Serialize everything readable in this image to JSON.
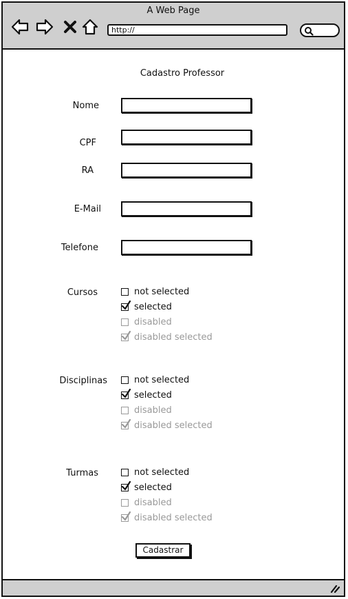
{
  "window": {
    "title": "A Web Page"
  },
  "toolbar": {
    "url": "http://"
  },
  "form": {
    "title": "Cadastro Professor",
    "fields": [
      {
        "label": "Nome",
        "value": ""
      },
      {
        "label": "CPF",
        "value": ""
      },
      {
        "label": "RA",
        "value": ""
      },
      {
        "label": "E-Mail",
        "value": ""
      },
      {
        "label": "Telefone",
        "value": ""
      }
    ],
    "groups": [
      {
        "label": "Cursos",
        "options": [
          {
            "label": "not selected",
            "checked": false,
            "disabled": false
          },
          {
            "label": "selected",
            "checked": true,
            "disabled": false
          },
          {
            "label": "disabled",
            "checked": false,
            "disabled": true
          },
          {
            "label": "disabled selected",
            "checked": true,
            "disabled": true
          }
        ]
      },
      {
        "label": "Disciplinas",
        "options": [
          {
            "label": "not selected",
            "checked": false,
            "disabled": false
          },
          {
            "label": "selected",
            "checked": true,
            "disabled": false
          },
          {
            "label": "disabled",
            "checked": false,
            "disabled": true
          },
          {
            "label": "disabled selected",
            "checked": true,
            "disabled": true
          }
        ]
      },
      {
        "label": "Turmas",
        "options": [
          {
            "label": "not selected",
            "checked": false,
            "disabled": false
          },
          {
            "label": "selected",
            "checked": true,
            "disabled": false
          },
          {
            "label": "disabled",
            "checked": false,
            "disabled": true
          },
          {
            "label": "disabled selected",
            "checked": true,
            "disabled": true
          }
        ]
      }
    ],
    "submit_label": "Cadastrar"
  }
}
